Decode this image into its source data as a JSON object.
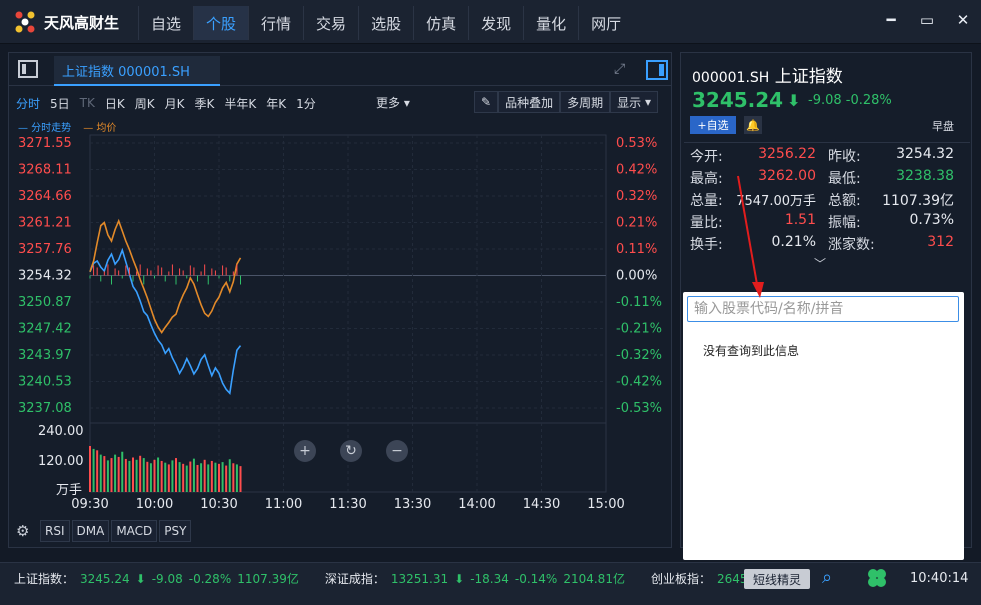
{
  "app": {
    "brand": "天风高财生"
  },
  "nav": {
    "items": [
      "自选",
      "个股",
      "行情",
      "交易",
      "选股",
      "仿真",
      "发现",
      "量化",
      "网厅"
    ],
    "active_index": 1
  },
  "window_controls": {
    "minimize": "━",
    "maximize": "▭",
    "close": "✕"
  },
  "tab": {
    "title": "上证指数 000001.SH"
  },
  "periods": [
    {
      "label": "分时",
      "state": "active"
    },
    {
      "label": "5日",
      "state": "normal"
    },
    {
      "label": "TK",
      "state": "disabled"
    },
    {
      "label": "日K",
      "state": "normal"
    },
    {
      "label": "周K",
      "state": "normal"
    },
    {
      "label": "月K",
      "state": "normal"
    },
    {
      "label": "季K",
      "state": "normal"
    },
    {
      "label": "半年K",
      "state": "normal"
    },
    {
      "label": "年K",
      "state": "normal"
    },
    {
      "label": "1分",
      "state": "normal"
    }
  ],
  "more_label": "更多",
  "tools": {
    "overlay": "品种叠加",
    "multi_period": "多周期",
    "display": "显示"
  },
  "legend": {
    "line1": "— 分时走势",
    "line2": "— 均价"
  },
  "chart_data": {
    "type": "line",
    "x_ticks": [
      "09:30",
      "10:00",
      "10:30",
      "11:00",
      "11:30",
      "13:30",
      "14:00",
      "14:30",
      "15:00"
    ],
    "y_ticks": [
      "3271.55",
      "3268.11",
      "3264.66",
      "3261.21",
      "3257.76",
      "3254.32",
      "3250.87",
      "3247.42",
      "3243.97",
      "3240.53",
      "3237.08"
    ],
    "pct_ticks": [
      "0.53%",
      "0.42%",
      "0.32%",
      "0.21%",
      "0.11%",
      "0.00%",
      "-0.11%",
      "-0.21%",
      "-0.32%",
      "-0.42%",
      "-0.53%"
    ],
    "volume_ticks": [
      "240.00",
      "120.00",
      "万手"
    ],
    "ylim": [
      3237.08,
      3271.55
    ],
    "prev_close": 3254.32,
    "series": [
      {
        "values": [
          3254.8,
          3255.9,
          3256.2,
          3255.4,
          3254.9,
          3256.3,
          3257.1,
          3255.8,
          3256.4,
          3257.6,
          3256.1,
          3254.5,
          3252.9,
          3252.2,
          3251.0,
          3249.6,
          3249.1,
          3247.9,
          3246.8,
          3245.9,
          3245.3,
          3244.2,
          3244.8,
          3243.6,
          3242.7,
          3241.6,
          3242.4,
          3243.5,
          3242.6,
          3241.5,
          3242.2,
          3243.4,
          3244.0,
          3242.6,
          3241.3,
          3242.3,
          3241.6,
          3240.3,
          3239.5,
          3239.0,
          3242.0,
          3244.6,
          3245.2
        ]
      },
      {
        "values": [
          3254.8,
          3256.2,
          3258.6,
          3260.8,
          3261.2,
          3259.6,
          3258.8,
          3260.3,
          3261.4,
          3260.1,
          3258.8,
          3257.7,
          3256.4,
          3255.2,
          3253.8,
          3252.6,
          3251.4,
          3250.0,
          3248.6,
          3247.6,
          3246.9,
          3247.6,
          3248.2,
          3248.9,
          3249.3,
          3250.7,
          3251.8,
          3252.7,
          3254.0,
          3253.2,
          3251.8,
          3250.5,
          3249.4,
          3249.0,
          3249.7,
          3250.8,
          3251.5,
          3252.7,
          3253.4,
          3252.2,
          3253.5,
          3255.8,
          3256.6
        ]
      }
    ],
    "volume": [
      160,
      150,
      145,
      130,
      125,
      110,
      118,
      130,
      122,
      140,
      115,
      108,
      120,
      112,
      126,
      118,
      105,
      100,
      112,
      120,
      108,
      102,
      96,
      110,
      118,
      104,
      98,
      92,
      106,
      116,
      94,
      100,
      112,
      96,
      108,
      102,
      98,
      104,
      92,
      114,
      100,
      96,
      90
    ]
  },
  "zoom_controls": {
    "plus": "+",
    "reset": "↻",
    "minus": "−"
  },
  "indicators": [
    "RSI",
    "DMA",
    "MACD",
    "PSY"
  ],
  "quote": {
    "code": "000001.SH",
    "name": "上证指数",
    "price": "3245.24",
    "change": "-9.08 -0.28%",
    "add_fav": "+自选",
    "session": "早盘"
  },
  "stats": {
    "open_label": "今开:",
    "open": "3256.22",
    "prev_label": "昨收:",
    "prev": "3254.32",
    "high_label": "最高:",
    "high": "3262.00",
    "low_label": "最低:",
    "low": "3238.38",
    "vol_label": "总量:",
    "vol": "7547.00万手",
    "amt_label": "总额:",
    "amt": "1107.39亿",
    "ratio_label": "量比:",
    "ratio": "1.51",
    "amp_label": "振幅:",
    "amp": "0.73%",
    "turn_label": "换手:",
    "turn": "0.21%",
    "up_label": "涨家数:",
    "up": "312"
  },
  "search": {
    "placeholder": "输入股票代码/名称/拼音",
    "no_result": "没有查询到此信息"
  },
  "ticker": {
    "sh_label": "上证指数：",
    "sh_value": "3245.24",
    "sh_change": "-9.08",
    "sh_pct": "-0.28%",
    "sh_amt": "1107.39亿",
    "sz_label": "深证成指：",
    "sz_value": "13251.31",
    "sz_change": "-18.34",
    "sz_pct": "-0.14%",
    "sz_amt": "2104.81亿",
    "cy_label": "创业板指：",
    "cy_value": "2645.0"
  },
  "shortline_label": "短线精灵",
  "clock": "10:40:14",
  "colors": {
    "accent": "#3aa0ff",
    "up": "#ff4d4d",
    "down": "#2fc069",
    "avg_line": "#e38a29"
  }
}
